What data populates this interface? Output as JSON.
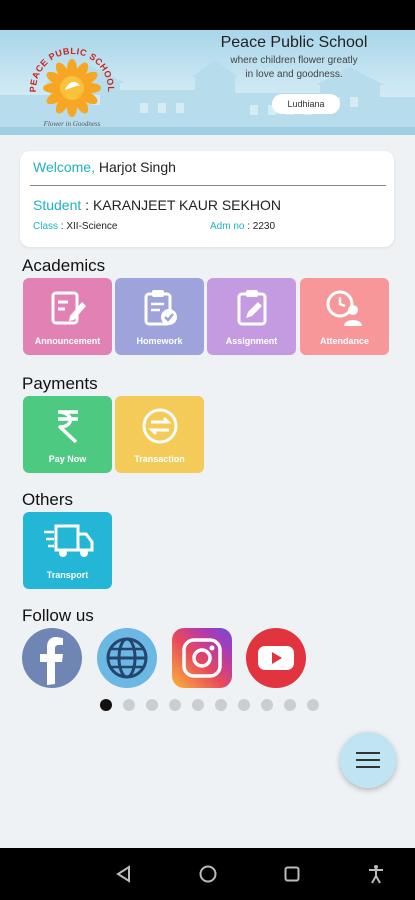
{
  "header": {
    "school_name": "Peace Public School",
    "tagline_line1": "where children flower greatly",
    "tagline_line2": "in love and goodness.",
    "city": "Ludhiana",
    "logo_text": "PEACE PUBLIC SCHOOL",
    "logo_motto": "Flower in Goodness"
  },
  "profile": {
    "welcome_label": "Welcome,",
    "user_name": "Harjot Singh",
    "student_label": "Student",
    "student_sep": " : ",
    "student_name": "KARANJEET KAUR SEKHON",
    "class_label": "Class",
    "class_value": " : XII-Science",
    "adm_label": "Adm no",
    "adm_value": " : 2230"
  },
  "sections": {
    "academics": "Academics",
    "payments": "Payments",
    "others": "Others",
    "follow": "Follow us"
  },
  "tiles": {
    "announcement": {
      "label": "Announcement",
      "color": "#e282b4"
    },
    "homework": {
      "label": "Homework",
      "color": "#9ea3dc"
    },
    "assignment": {
      "label": "Assignment",
      "color": "#c49be0"
    },
    "attendance": {
      "label": "Attendance",
      "color": "#f7979a"
    },
    "pay_now": {
      "label": "Pay Now",
      "color": "#4ec982"
    },
    "transaction": {
      "label": "Transaction",
      "color": "#f4cb58"
    },
    "transport": {
      "label": "Transport",
      "color": "#23b6d6"
    }
  },
  "social_icons": [
    "facebook-icon",
    "globe-icon",
    "instagram-icon",
    "youtube-icon"
  ],
  "pager": {
    "count": 10,
    "active": 0
  },
  "colors": {
    "accent": "#1fb3c1",
    "fab": "#bfe5f3"
  }
}
